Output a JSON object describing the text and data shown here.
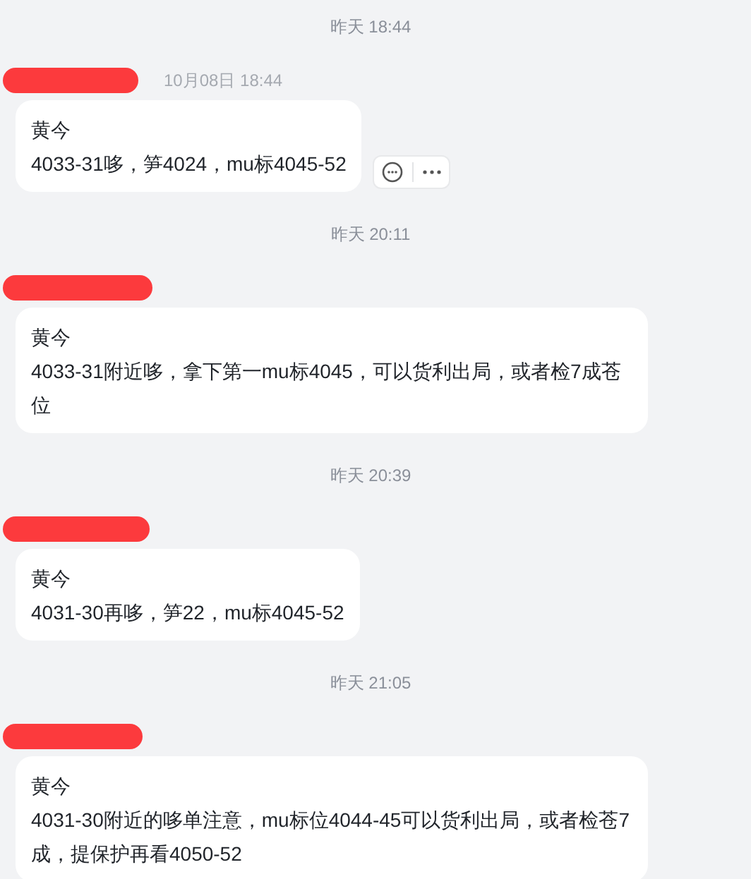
{
  "groups": [
    {
      "time": "昨天 18:44",
      "messages": [
        {
          "sent_time": "10月08日 18:44",
          "show_actions": true,
          "lines": [
            "黄今",
            "4033-31哆，笋4024，mu标4045-52"
          ]
        }
      ]
    },
    {
      "time": "昨天 20:11",
      "messages": [
        {
          "show_actions": false,
          "lines": [
            "黄今",
            "4033-31附近哆，拿下第一mu标4045，可以货利出局，或者检7成苍位"
          ]
        }
      ]
    },
    {
      "time": "昨天 20:39",
      "messages": [
        {
          "show_actions": false,
          "lines": [
            "黄今",
            "4031-30再哆，笋22，mu标4045-52"
          ]
        }
      ]
    },
    {
      "time": "昨天 21:05",
      "messages": [
        {
          "show_actions": false,
          "lines": [
            "黄今",
            "4031-30附近的哆单注意，mu标位4044-45可以货利出局，或者检苍7成，提保护再看4050-52"
          ]
        }
      ]
    }
  ]
}
